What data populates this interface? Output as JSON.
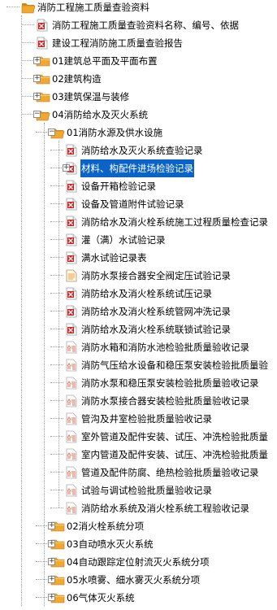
{
  "tree": {
    "root": {
      "label": "消防工程施工质量查验资料",
      "icon": "folder-open-icon"
    },
    "items": [
      {
        "label": "消防工程施工质量查验资料名称、编号、依据",
        "icon": "pdf-icon",
        "depth": 1
      },
      {
        "label": "建设工程消防施工质量查验报告",
        "icon": "pdf-icon",
        "depth": 1
      },
      {
        "label": "01建筑总平面及平面布置",
        "icon": "folder-icon",
        "depth": 1,
        "expander": "+"
      },
      {
        "label": "02建筑构造",
        "icon": "folder-icon",
        "depth": 1,
        "expander": "+"
      },
      {
        "label": "03建筑保温与装修",
        "icon": "folder-icon",
        "depth": 1,
        "expander": "+"
      },
      {
        "label": "04消防给水及灭火系统",
        "icon": "folder-open-icon",
        "depth": 1,
        "expander": "-"
      },
      {
        "label": "01消防水源及供水设施",
        "icon": "folder-open-icon",
        "depth": 2,
        "expander": "-"
      },
      {
        "label": "消防给水及灭火系统查验记录",
        "icon": "pdf-icon",
        "depth": 3
      },
      {
        "label": "材料、构配件进场检验记录",
        "icon": "pdf-icon",
        "depth": 3,
        "expander": "+",
        "selected": true
      },
      {
        "label": "设备开箱检验记录",
        "icon": "pdf-icon",
        "depth": 3
      },
      {
        "label": "设备及管道附件试验记录",
        "icon": "pdf-icon",
        "depth": 3
      },
      {
        "label": "消防给水及消火栓系统施工过程质量检查记录",
        "icon": "pdf-icon",
        "depth": 3
      },
      {
        "label": "灌（满）水试验记录",
        "icon": "pdf-icon",
        "depth": 3
      },
      {
        "label": "满水试验记录表",
        "icon": "pdf-icon",
        "depth": 3
      },
      {
        "label": "消防水泵接合器安全阀定压试验记录",
        "icon": "doc-icon",
        "depth": 3
      },
      {
        "label": "消防给水及消火栓系统试压记录",
        "icon": "pdf-icon",
        "depth": 3
      },
      {
        "label": "消防给水及消火栓系统管网冲洗记录",
        "icon": "pdf-icon",
        "depth": 3
      },
      {
        "label": "消防给水及消火栓系统联锁试验记录",
        "icon": "pdf-icon",
        "depth": 3
      },
      {
        "label": "消防水箱和消防水池检验批质量验收记录",
        "icon": "inspection-icon",
        "depth": 3
      },
      {
        "label": "消防气压给水设备和稳压泵安装检验批质量验",
        "icon": "inspection-icon",
        "depth": 3
      },
      {
        "label": "消防水泵和稳压泵安装检验批质量验收记录",
        "icon": "inspection-icon",
        "depth": 3
      },
      {
        "label": "消防水泵接合器安装检验批质量验收记录",
        "icon": "inspection-icon",
        "depth": 3
      },
      {
        "label": "管沟及井室检验批质量验收记录",
        "icon": "inspection-icon",
        "depth": 3
      },
      {
        "label": "室外管道及配件安装、试压、冲洗检验批质量",
        "icon": "inspection-icon",
        "depth": 3
      },
      {
        "label": "室内管道及配件安装、试压、冲洗检验批质量",
        "icon": "inspection-icon",
        "depth": 3
      },
      {
        "label": "管道及配件防腐、绝热检验批质量验收记录",
        "icon": "inspection-icon",
        "depth": 3
      },
      {
        "label": "试验与调试检验批质量验收记录",
        "icon": "inspection-icon",
        "depth": 3
      },
      {
        "label": "消防给水系统及消火栓系统工程验收记录",
        "icon": "inspection-icon",
        "depth": 3
      },
      {
        "label": "02消火栓系统分项",
        "icon": "folder-icon",
        "depth": 2,
        "expander": "+"
      },
      {
        "label": "03自动喷水灭火系统",
        "icon": "folder-icon",
        "depth": 2,
        "expander": "+"
      },
      {
        "label": "04自动跟踪定位射流灭火系统分项",
        "icon": "folder-icon",
        "depth": 2,
        "expander": "+"
      },
      {
        "label": "05水喷雾、细水雾灭火系统分项",
        "icon": "folder-icon",
        "depth": 2,
        "expander": "+"
      },
      {
        "label": "06气体灭火系统",
        "icon": "folder-icon",
        "depth": 2,
        "expander": "+"
      }
    ]
  },
  "colors": {
    "selection": "#0a64c8",
    "folder": "#f0a830",
    "pdf": "#d81e1e",
    "inspection": "#e07050",
    "doc": "#e8a040",
    "tree_lines": "#a0a0a0"
  }
}
